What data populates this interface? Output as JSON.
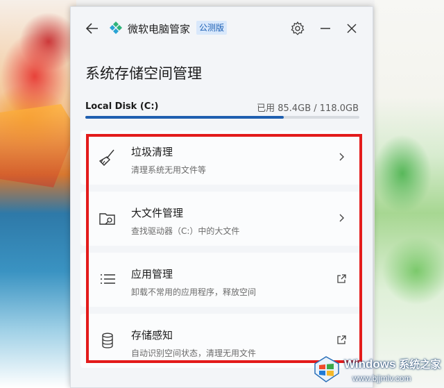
{
  "app": {
    "name": "微软电脑管家",
    "badge": "公测版"
  },
  "page": {
    "title": "系统存储空间管理"
  },
  "disk": {
    "name": "Local Disk (C:)",
    "usage_text": "已用 85.4GB / 118.0GB",
    "used_fraction": 0.724
  },
  "items": [
    {
      "title": "垃圾清理",
      "subtitle": "清理系统无用文件等",
      "icon": "broom-icon",
      "action": "chevron-right-icon"
    },
    {
      "title": "大文件管理",
      "subtitle": "查找驱动器（C:）中的大文件",
      "icon": "folder-search-icon",
      "action": "chevron-right-icon"
    },
    {
      "title": "应用管理",
      "subtitle": "卸载不常用的应用程序，释放空间",
      "icon": "list-icon",
      "action": "open-external-icon"
    },
    {
      "title": "存储感知",
      "subtitle": "自动识别空间状态，清理无用文件",
      "icon": "database-icon",
      "action": "open-external-icon"
    }
  ],
  "watermark": {
    "title": "Windows",
    "title_cn": "系统之家",
    "url": "www.bjjmlv.com"
  },
  "colors": {
    "accent": "#1f5fb0",
    "highlight": "#e31b1b"
  }
}
